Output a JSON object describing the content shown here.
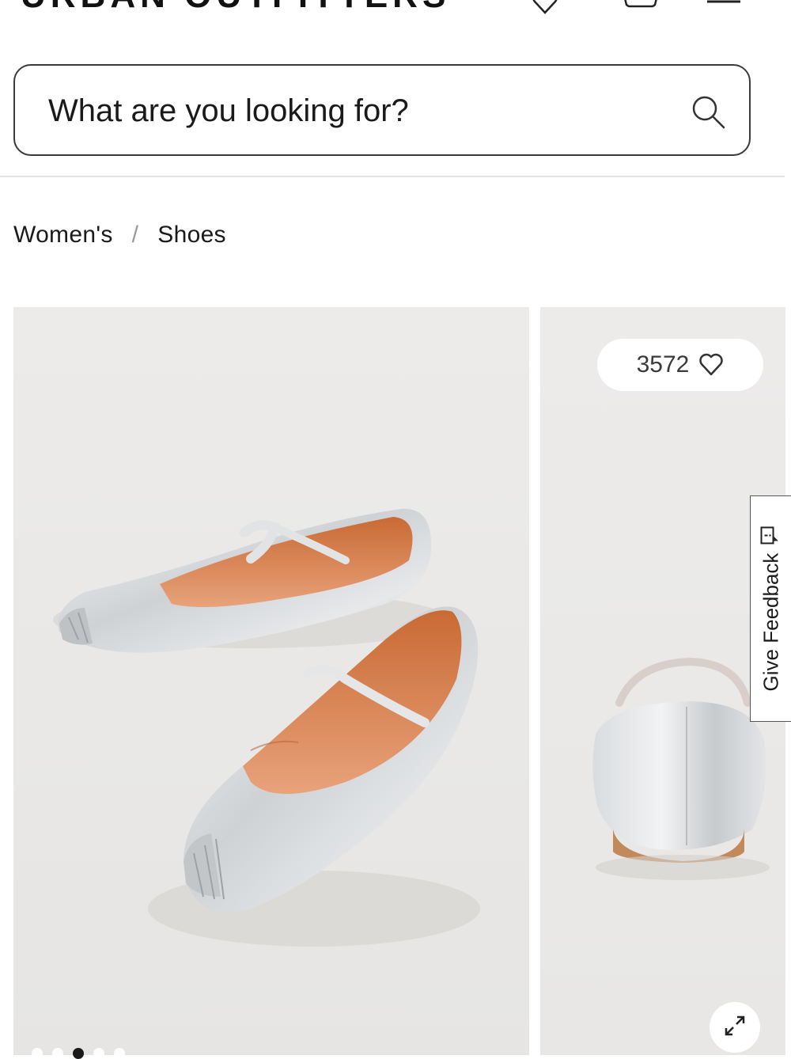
{
  "header": {
    "logo_text": "URBAN OUTFITTERS",
    "icons": [
      "heart-icon",
      "bag-icon",
      "menu-icon"
    ]
  },
  "search": {
    "placeholder": "What are you looking for?",
    "icon": "search-icon"
  },
  "breadcrumb": {
    "items": [
      {
        "label": "Women's"
      },
      {
        "label": "Shoes"
      }
    ],
    "separator": "/"
  },
  "gallery": {
    "main_image": "silver mary jane ballet flats pair",
    "side_image": "silver ballet flat back view",
    "like_count": "3572",
    "like_icon": "heart-icon",
    "expand_icon": "expand-icon",
    "dot_count": 5,
    "active_dot_index": 2
  },
  "feedback": {
    "label": "Give Feedback",
    "icon": "feedback-icon"
  },
  "colors": {
    "text": "#1a1a1a",
    "image_bg": "#eae9e7",
    "shoe_silver": "#d9dbdd",
    "shoe_lining": "#d9804d"
  }
}
